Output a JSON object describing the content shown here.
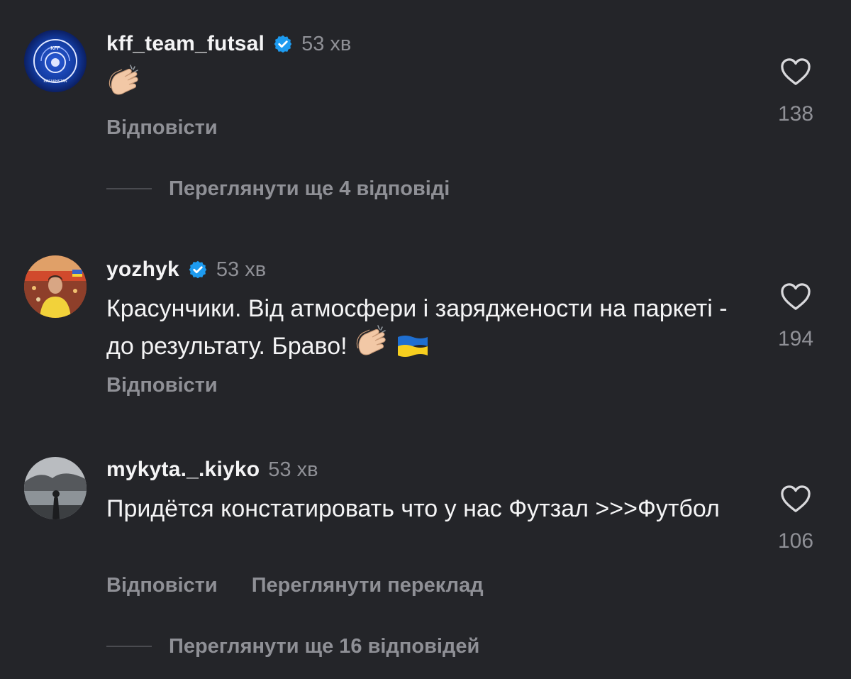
{
  "comments": [
    {
      "username": "kff_team_futsal",
      "verified": true,
      "time": "53 хв",
      "text": "",
      "emojis": [
        "clapping-hands"
      ],
      "reply_label": "Відповісти",
      "likes": "138",
      "avatar": "kff-logo"
    },
    {
      "username": "yozhyk",
      "verified": true,
      "time": "53 хв",
      "text": "Красунчики. Від атмосфери і заряджености на паркеті - до результату. Браво!",
      "emojis": [
        "clapping-hands",
        "ukraine-flag"
      ],
      "reply_label": "Відповісти",
      "likes": "194",
      "avatar": "person-yellow-shirt"
    },
    {
      "username": "mykyta._.kiyko",
      "verified": false,
      "time": "53 хв",
      "text": "Придётся констатировать что у нас Футзал >>>Футбол",
      "emojis": [],
      "reply_label": "Відповісти",
      "translate_label": "Переглянути переклад",
      "likes": "106",
      "avatar": "person-lakeside"
    }
  ],
  "view_more_replies": [
    "Переглянути ще 4 відповіді",
    "Переглянути ще 16 відповідей"
  ],
  "colors": {
    "background": "#242529",
    "primary_text": "#f4f4f5",
    "secondary_text": "#8f9096",
    "verified_badge": "#1d9bf0"
  }
}
